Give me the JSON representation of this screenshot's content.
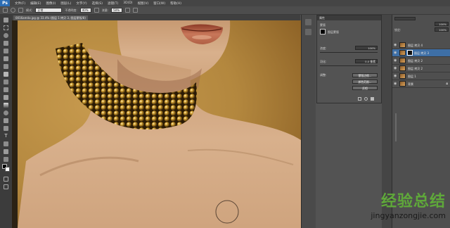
{
  "app": {
    "logo": "Ps",
    "menu": [
      "文件(F)",
      "编辑(E)",
      "图像(I)",
      "图层(L)",
      "文字(Y)",
      "选择(S)",
      "滤镜(T)",
      "3D(D)",
      "视图(V)",
      "窗口(W)",
      "帮助(H)"
    ]
  },
  "options": {
    "mode_label": "模式:",
    "mode_value": "正常",
    "opacity_label": "不透明度:",
    "opacity_value": "40%",
    "flow_label": "流量:",
    "flow_value": "50%"
  },
  "document": {
    "tab": "0016am4o.jpg @ 33.4% (图层 1 拷贝 3, 图层蒙版/8)"
  },
  "properties": {
    "header": "属性",
    "section": "蒙版",
    "mask_type": "图层蒙版",
    "density_label": "浓度:",
    "density_value": "100%",
    "feather_label": "羽化:",
    "feather_value": "0.0 像素",
    "adjust_label": "调整:",
    "btn_edge": "蒙版边缘...",
    "btn_color": "颜色范围...",
    "btn_invert": "反相"
  },
  "layers": {
    "header_lock": "锁定:",
    "opacity_value": "100%",
    "fill_value": "100%",
    "items": [
      {
        "name": "图层 拷贝 4"
      },
      {
        "name": "图层 拷贝 3"
      },
      {
        "name": "图层 拷贝 2"
      },
      {
        "name": "图层 拷贝 2"
      },
      {
        "name": "图层 1"
      },
      {
        "name": "背景"
      }
    ]
  },
  "watermark": {
    "title": "经验总结",
    "url": "jingyanzongjie.com"
  },
  "colors": {
    "ps_blue": "#2c6db4",
    "watermark_green": "#5fa83a",
    "watermark_red": "#d0342c",
    "selected_layer": "#3e6fa6"
  }
}
